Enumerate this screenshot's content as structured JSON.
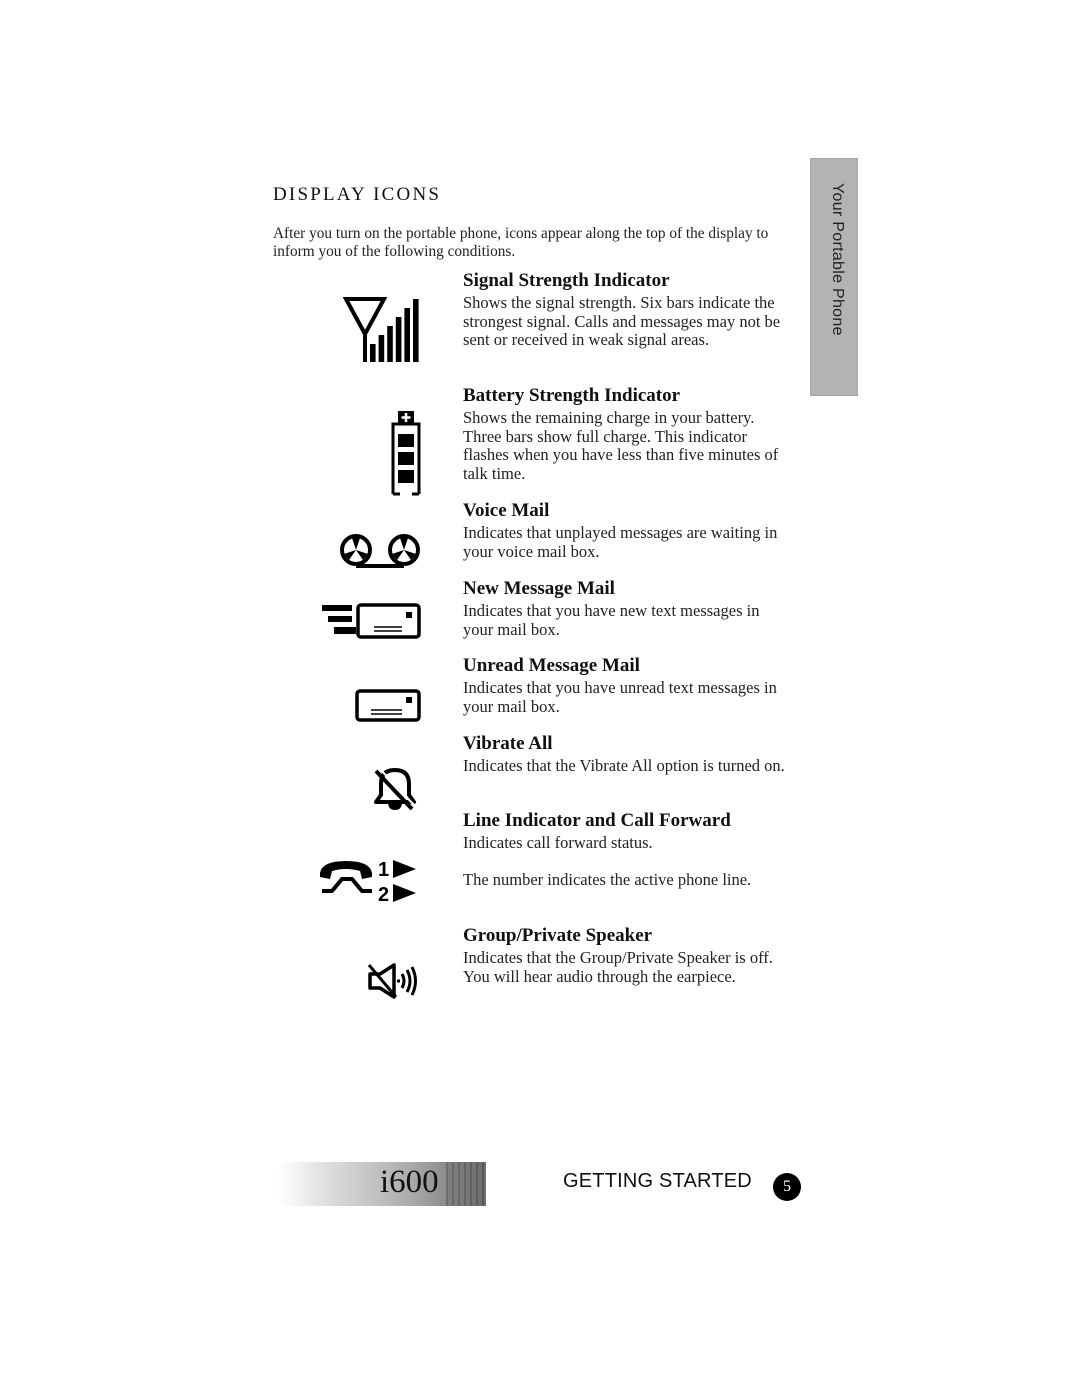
{
  "section": {
    "title": "DISPLAY ICONS",
    "intro": "After you turn on the portable phone, icons appear along the top of the display to inform you of the following conditions."
  },
  "side_tab": {
    "label": "Your Portable Phone"
  },
  "entries": [
    {
      "icon": "signal-strength-icon",
      "title": "Signal Strength Indicator",
      "body": "Shows the signal strength. Six bars indicate the strongest signal. Calls and messages may not be sent or received in weak signal areas."
    },
    {
      "icon": "battery-icon",
      "title": "Battery Strength Indicator",
      "body": "Shows the remaining charge in your battery. Three bars show full charge. This indicator flashes when you have less than five minutes of talk time."
    },
    {
      "icon": "voice-mail-icon",
      "title": "Voice Mail",
      "body": "Indicates that unplayed messages are waiting in your voice mail box."
    },
    {
      "icon": "new-message-mail-icon",
      "title": "New Message Mail",
      "body": "Indicates that you have new text messages in your mail box."
    },
    {
      "icon": "unread-message-mail-icon",
      "title": "Unread Message Mail",
      "body": "Indicates that you have unread text messages in your mail box."
    },
    {
      "icon": "vibrate-all-icon",
      "title": "Vibrate All",
      "body": "Indicates that the Vibrate All option is turned on."
    },
    {
      "icon": "line-call-forward-icon",
      "title": "Line Indicator and Call Forward",
      "body": "Indicates call forward status.",
      "body2": "The number indicates the active phone line.",
      "line_numbers": [
        "1",
        "2"
      ]
    },
    {
      "icon": "speaker-off-icon",
      "title": "Group/Private Speaker",
      "body": "Indicates that the Group/Private Speaker is off. You will hear audio through the earpiece."
    }
  ],
  "icon_details": {
    "signal_bars": 6,
    "battery_bars": 3
  },
  "footer": {
    "model": "i600",
    "chapter": "GETTING STARTED",
    "page": "5"
  }
}
